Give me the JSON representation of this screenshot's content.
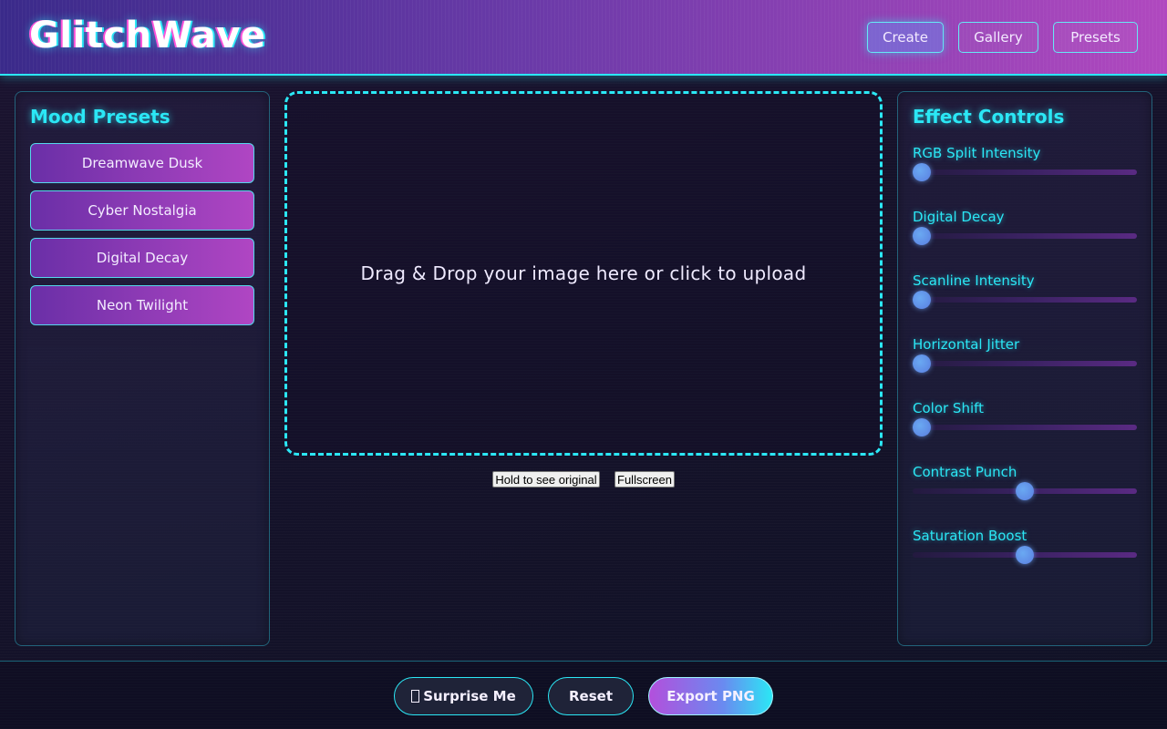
{
  "app": {
    "logo": "GlitchWave"
  },
  "nav": {
    "create": "Create",
    "gallery": "Gallery",
    "presets": "Presets"
  },
  "mood_presets": {
    "title": "Mood Presets",
    "items": [
      {
        "label": "Dreamwave Dusk"
      },
      {
        "label": "Cyber Nostalgia"
      },
      {
        "label": "Digital Decay"
      },
      {
        "label": "Neon Twilight"
      }
    ]
  },
  "dropzone": {
    "text": "Drag & Drop your image here or click to upload"
  },
  "preview_buttons": {
    "hold": "Hold to see original",
    "fullscreen": "Fullscreen"
  },
  "effect_controls": {
    "title": "Effect Controls",
    "sliders": [
      {
        "label": "RGB Split Intensity",
        "value": 0
      },
      {
        "label": "Digital Decay",
        "value": 0
      },
      {
        "label": "Scanline Intensity",
        "value": 0
      },
      {
        "label": "Horizontal Jitter",
        "value": 0
      },
      {
        "label": "Color Shift",
        "value": 0
      },
      {
        "label": "Contrast Punch",
        "value": 0.5
      },
      {
        "label": "Saturation Boost",
        "value": 0.5
      }
    ]
  },
  "footer": {
    "surprise": "Surprise Me",
    "reset": "Reset",
    "export": "Export PNG"
  },
  "colors": {
    "accent": "#2be7f5",
    "magenta": "#b046c3",
    "purple": "#6a2fa7"
  }
}
